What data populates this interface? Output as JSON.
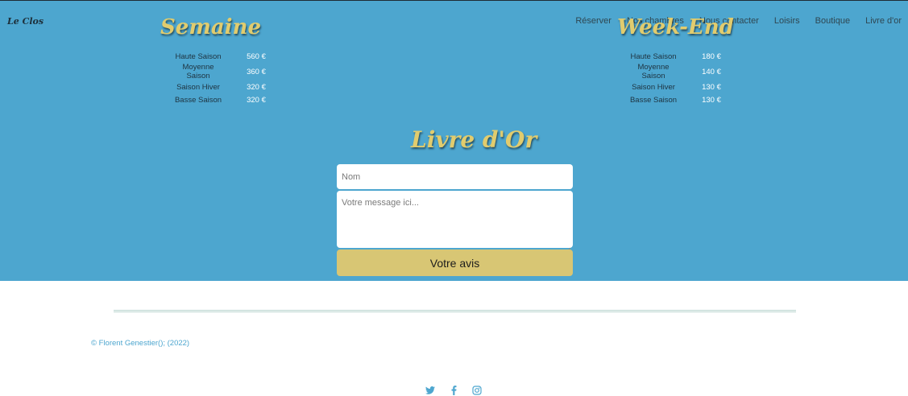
{
  "brand": "Le Clos",
  "nav": {
    "items": [
      "Réserver",
      "Nos chambres",
      "Nous contacter",
      "Loisirs",
      "Boutique",
      "Livre d'or"
    ]
  },
  "pricing": {
    "semaine": {
      "title": "Semaine",
      "rows": [
        {
          "label": "Haute Saison",
          "price": "560 €"
        },
        {
          "label": "Moyenne Saison",
          "price": "360 €"
        },
        {
          "label": "Saison Hiver",
          "price": "320 €"
        },
        {
          "label": "Basse Saison",
          "price": "320 €"
        }
      ]
    },
    "weekend": {
      "title": "Week-End",
      "rows": [
        {
          "label": "Haute Saison",
          "price": "180 €"
        },
        {
          "label": "Moyenne Saison",
          "price": "140 €"
        },
        {
          "label": "Saison Hiver",
          "price": "130 €"
        },
        {
          "label": "Basse Saison",
          "price": "130 €"
        }
      ]
    }
  },
  "guestbook": {
    "title": "Livre d'Or",
    "name_placeholder": "Nom",
    "message_placeholder": "Votre message ici...",
    "submit_label": "Votre avis"
  },
  "footer": {
    "copyright": "© Florent Genestier(); (2022)",
    "social_icons": [
      "twitter-icon",
      "facebook-icon",
      "instagram-icon"
    ]
  },
  "colors": {
    "hero_background": "#4da6cf",
    "accent_gold": "#d8c674",
    "title_gold": "#e1cc6e"
  }
}
